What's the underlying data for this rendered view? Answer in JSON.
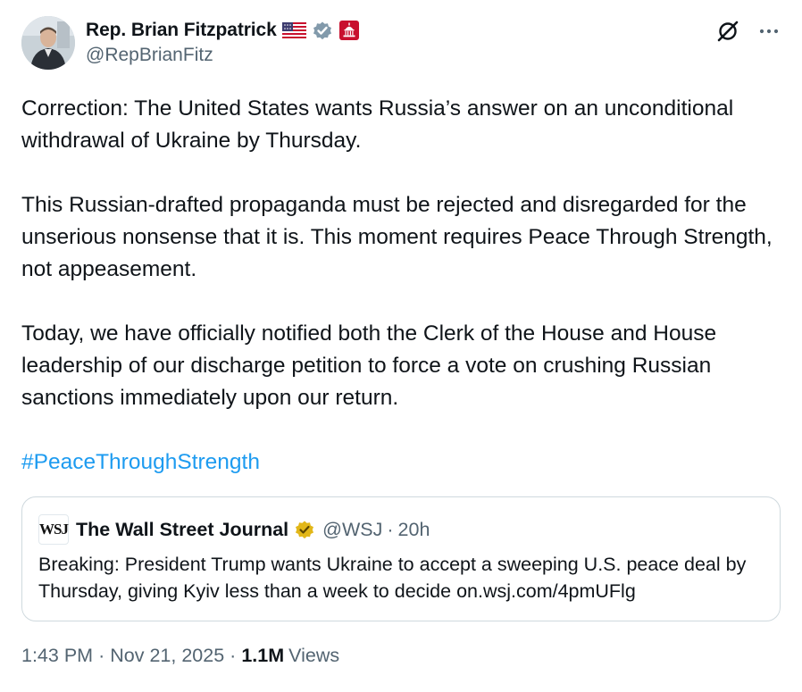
{
  "author": {
    "display_name": "Rep. Brian Fitzpatrick",
    "handle": "@RepBrianFitz"
  },
  "icons": {
    "header_actions": [
      "grok-icon",
      "more-options-icon"
    ],
    "badges": [
      "us-flag-icon",
      "verified-gray-icon",
      "capitol-icon"
    ],
    "quote_badge": "verified-gold-icon"
  },
  "colors": {
    "text_primary": "#0f1419",
    "text_secondary": "#536471",
    "link": "#1d9bf0",
    "border": "#cfd9de",
    "verified_gray": "#829aab",
    "verified_gold": "#e2b719",
    "capitol_red": "#c8102e"
  },
  "tweet": {
    "paragraph_1": "Correction: The United States wants Russia’s answer on an unconditional withdrawal of Ukraine by Thursday.",
    "paragraph_2": "This Russian-drafted propaganda must be rejected and disregarded for the unserious nonsense that it is. This moment requires Peace Through Strength, not appeasement.",
    "paragraph_3": "Today, we have officially notified both the Clerk of the House and House leadership of our discharge petition to force a vote on crushing Russian sanctions immediately upon our return.",
    "hashtag": "#PeaceThroughStrength"
  },
  "quote": {
    "logo_text": "WSJ",
    "display_name": "The Wall Street Journal",
    "handle": "@WSJ",
    "separator": "·",
    "time": "20h",
    "text": "Breaking: President Trump wants Ukraine to accept a sweeping U.S. peace deal by Thursday, giving Kyiv less than a week to decide on.wsj.com/4pmUFlg"
  },
  "meta": {
    "time": "1:43 PM",
    "separator": "·",
    "date": "Nov 21, 2025",
    "views_count": "1.1M",
    "views_label": "Views"
  }
}
